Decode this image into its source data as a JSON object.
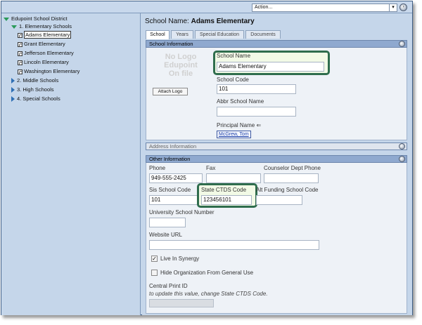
{
  "topbar": {
    "action_label": "Action...",
    "arrow": "▾",
    "go": "›"
  },
  "tree": {
    "root": "Edupoint School District",
    "groups": [
      {
        "label": "1. Elementary Schools"
      },
      {
        "label": "2. Middle Schools"
      },
      {
        "label": "3. High Schools"
      },
      {
        "label": "4. Special Schools"
      }
    ],
    "elementary": [
      "Adams Elementary",
      "Grant Elementary",
      "Jefferson Elementary",
      "Lincoln Elementary",
      "Washington Elementary"
    ]
  },
  "header": {
    "prefix": "School Name:",
    "name": "Adams Elementary"
  },
  "tabs": [
    {
      "label": "School"
    },
    {
      "label": "Years"
    },
    {
      "label": "Special Education"
    },
    {
      "label": "Documents"
    }
  ],
  "school_info": {
    "title": "School Information",
    "logo_line1": "No Logo",
    "logo_line2": "Edupoint",
    "logo_line3": "On file",
    "attach_logo": "Attach Logo",
    "school_name_label": "School Name",
    "school_name_value": "Adams Elementary",
    "school_code_label": "School Code",
    "school_code_value": "101",
    "abbr_label": "Abbr School Name",
    "abbr_value": "",
    "principal_label": "Principal Name",
    "principal_arrow": "⇐",
    "principal_value": "McGrew, Tom"
  },
  "address_info": {
    "title": "Address Information"
  },
  "other_info": {
    "title": "Other Information",
    "phone_label": "Phone",
    "phone_value": "949-555-2425",
    "fax_label": "Fax",
    "fax_value": "",
    "counselor_label": "Counselor Dept Phone",
    "counselor_value": "",
    "sis_label": "Sis School Code",
    "sis_value": "101",
    "ctds_label": "State CTDS Code",
    "ctds_value": "123456101",
    "alt_label": "Alt Funding School Code",
    "alt_value": "",
    "univ_label": "University School Number",
    "univ_value": "",
    "website_label": "Website URL",
    "website_value": "",
    "live_label": "Live In Synergy",
    "live_checked": "✓",
    "hide_label": "Hide Organization From General Use",
    "central_label": "Central Print ID",
    "central_hint": "to update this value, change State CTDS Code."
  }
}
